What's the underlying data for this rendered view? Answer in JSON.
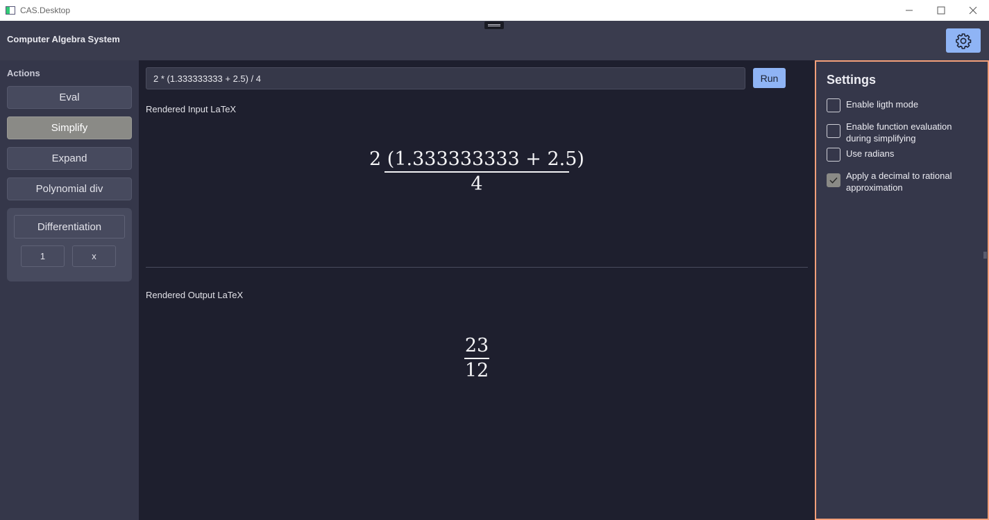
{
  "window": {
    "title": "CAS.Desktop",
    "controls": [
      "minimize",
      "maximize",
      "close"
    ]
  },
  "header": {
    "title": "Computer Algebra System",
    "settings_icon": "gear-icon"
  },
  "sidebar": {
    "label": "Actions",
    "buttons": [
      {
        "label": "Eval",
        "active": false
      },
      {
        "label": "Simplify",
        "active": true
      },
      {
        "label": "Expand",
        "active": false
      },
      {
        "label": "Polynomial div",
        "active": false
      }
    ],
    "differentiation": {
      "label": "Differentiation",
      "order": "1",
      "variable": "x"
    }
  },
  "main": {
    "input_value": "2 * (1.333333333 + 2.5) / 4",
    "run_label": "Run",
    "input_caption": "Rendered Input LaTeX",
    "input_latex": {
      "numerator": "2 (1.333333333 + 2.5)",
      "denominator": "4"
    },
    "output_caption": "Rendered Output LaTeX",
    "output_latex": {
      "numerator": "23",
      "denominator": "12"
    }
  },
  "settings": {
    "title": "Settings",
    "options": [
      {
        "label": "Enable ligth mode",
        "checked": false
      },
      {
        "label": "Enable function evaluation during simplifying",
        "checked": false
      },
      {
        "label": "Use radians",
        "checked": false
      },
      {
        "label": "Apply a decimal to rational approximation",
        "checked": true
      }
    ]
  },
  "colors": {
    "accent": "#8fb4f5",
    "panel_border": "#f4a07a",
    "active_button": "#8a8a86"
  }
}
